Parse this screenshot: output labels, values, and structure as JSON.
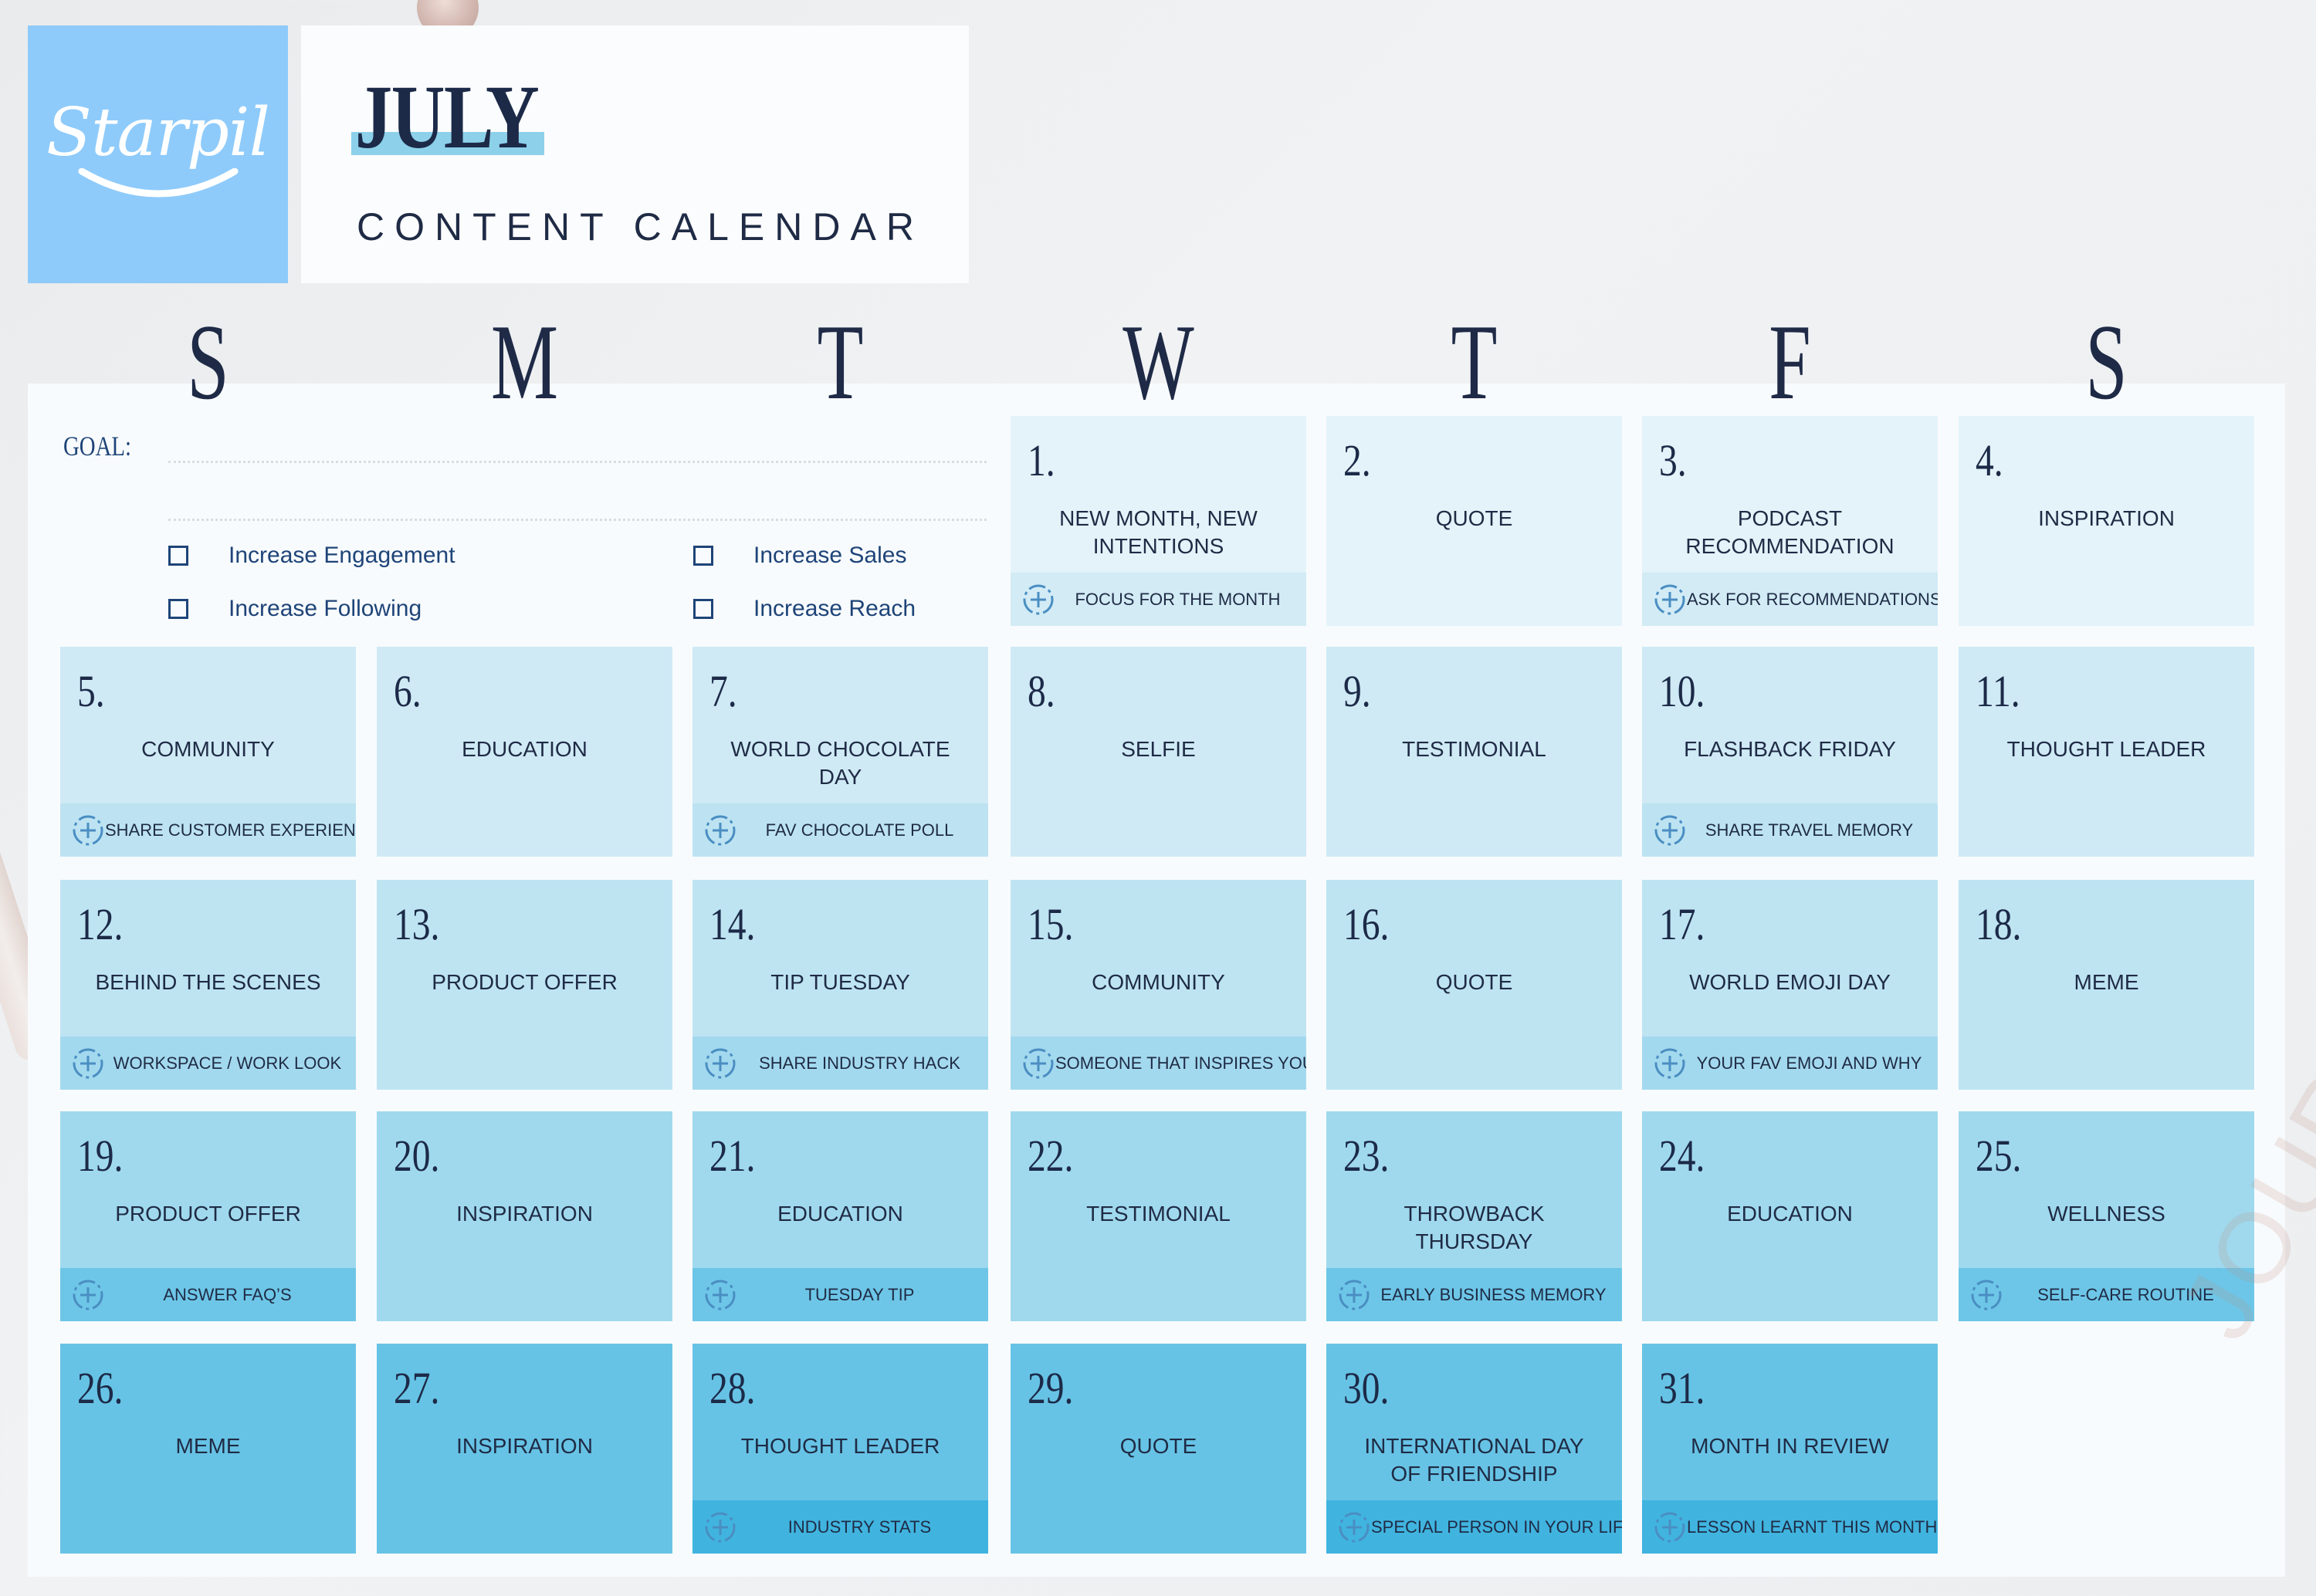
{
  "brand": {
    "name": "Starpil"
  },
  "header": {
    "month": "JULY",
    "subtitle": "CONTENT CALENDAR"
  },
  "weekdays": [
    "S",
    "M",
    "T",
    "W",
    "T",
    "F",
    "S"
  ],
  "goal": {
    "label": "GOAL:",
    "options": [
      {
        "label": "Increase Engagement",
        "checked": false
      },
      {
        "label": "Increase Sales",
        "checked": false
      },
      {
        "label": "Increase Following",
        "checked": false
      },
      {
        "label": "Increase Reach",
        "checked": false
      }
    ]
  },
  "colors": {
    "row1": "#e3f3f9",
    "row1_band": "#d2ebf5",
    "row2": "#cfeaf5",
    "row2_band": "#bde3f2",
    "row3": "#bee4f2",
    "row3_band": "#a3d9ee",
    "row4": "#a0d9ee",
    "row4_band": "#6dc6e7",
    "row5": "#67c3e5",
    "row5_band": "#40b4df",
    "logo_bg": "#8ecbfb",
    "text_dark": "#1c2a48",
    "accent_blue": "#1e4478"
  },
  "days": [
    {
      "day": "1.",
      "topic": "NEW MONTH, NEW INTENTIONS",
      "task": "FOCUS FOR THE MONTH"
    },
    {
      "day": "2.",
      "topic": "QUOTE",
      "task": ""
    },
    {
      "day": "3.",
      "topic": "PODCAST RECOMMENDATION",
      "task": "ASK FOR RECOMMENDATIONS"
    },
    {
      "day": "4.",
      "topic": "INSPIRATION",
      "task": ""
    },
    {
      "day": "5.",
      "topic": "COMMUNITY",
      "task": "SHARE CUSTOMER EXPERIENCE"
    },
    {
      "day": "6.",
      "topic": "EDUCATION",
      "task": ""
    },
    {
      "day": "7.",
      "topic": "WORLD CHOCOLATE DAY",
      "task": "FAV CHOCOLATE POLL"
    },
    {
      "day": "8.",
      "topic": "SELFIE",
      "task": ""
    },
    {
      "day": "9.",
      "topic": "TESTIMONIAL",
      "task": ""
    },
    {
      "day": "10.",
      "topic": "FLASHBACK FRIDAY",
      "task": "SHARE TRAVEL MEMORY"
    },
    {
      "day": "11.",
      "topic": "THOUGHT LEADER",
      "task": ""
    },
    {
      "day": "12.",
      "topic": "BEHIND THE SCENES",
      "task": "WORKSPACE / WORK LOOK"
    },
    {
      "day": "13.",
      "topic": "PRODUCT OFFER",
      "task": ""
    },
    {
      "day": "14.",
      "topic": "TIP TUESDAY",
      "task": "SHARE INDUSTRY HACK"
    },
    {
      "day": "15.",
      "topic": "COMMUNITY",
      "task": "SOMEONE THAT INSPIRES YOU"
    },
    {
      "day": "16.",
      "topic": "QUOTE",
      "task": ""
    },
    {
      "day": "17.",
      "topic": "WORLD EMOJI DAY",
      "task": "YOUR FAV EMOJI AND WHY"
    },
    {
      "day": "18.",
      "topic": "MEME",
      "task": ""
    },
    {
      "day": "19.",
      "topic": "PRODUCT OFFER",
      "task": "ANSWER FAQ’S"
    },
    {
      "day": "20.",
      "topic": "INSPIRATION",
      "task": ""
    },
    {
      "day": "21.",
      "topic": "EDUCATION",
      "task": "TUESDAY TIP"
    },
    {
      "day": "22.",
      "topic": "TESTIMONIAL",
      "task": ""
    },
    {
      "day": "23.",
      "topic": "THROWBACK THURSDAY",
      "task": "EARLY BUSINESS MEMORY"
    },
    {
      "day": "24.",
      "topic": "EDUCATION",
      "task": ""
    },
    {
      "day": "25.",
      "topic": "WELLNESS",
      "task": "SELF-CARE ROUTINE"
    },
    {
      "day": "26.",
      "topic": "MEME",
      "task": ""
    },
    {
      "day": "27.",
      "topic": "INSPIRATION",
      "task": ""
    },
    {
      "day": "28.",
      "topic": "THOUGHT LEADER",
      "task": "INDUSTRY STATS"
    },
    {
      "day": "29.",
      "topic": "QUOTE",
      "task": ""
    },
    {
      "day": "30.",
      "topic": "INTERNATIONAL DAY OF FRIENDSHIP",
      "task": "SPECIAL PERSON IN YOUR LIFE"
    },
    {
      "day": "31.",
      "topic": "MONTH IN REVIEW",
      "task": "LESSON LEARNT THIS MONTH"
    }
  ],
  "watermark": "JOURN"
}
